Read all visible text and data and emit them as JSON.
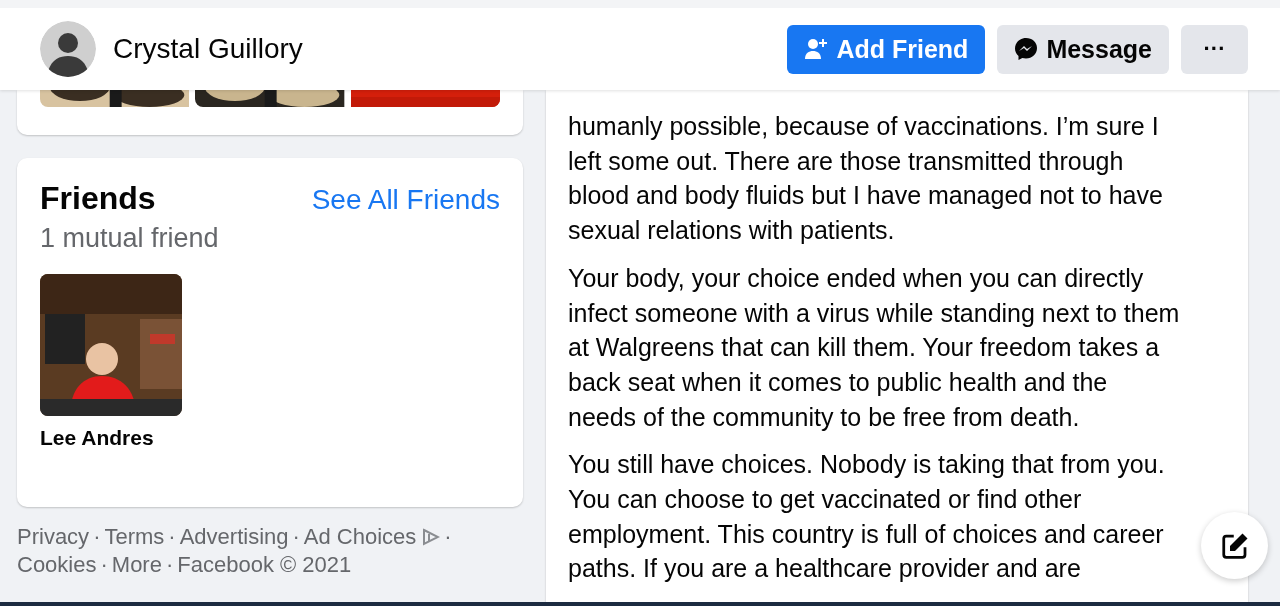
{
  "header": {
    "name": "Crystal Guillory",
    "buttons": [
      {
        "kind": "add_friend",
        "label": "Add Friend"
      },
      {
        "kind": "message",
        "label": "Message"
      },
      {
        "kind": "more",
        "label": "···"
      }
    ]
  },
  "friends": {
    "title": "Friends",
    "link": "See All Friends",
    "subtitle": "1 mutual friend",
    "items": [
      {
        "name": "Lee Andres"
      }
    ]
  },
  "footer": {
    "separator": "·",
    "links": [
      "Privacy",
      "Terms",
      "Advertising",
      "Ad Choices",
      "Cookies",
      "More"
    ],
    "copyright": "Facebook © 2021"
  },
  "post": {
    "paragraphs": [
      {
        "lines": [
          "humanly possible, because of vaccinations. I’m sure I",
          "left some out. There are those transmitted through",
          "blood and body fluids but I have managed not to have",
          "sexual relations with patients."
        ]
      },
      {
        "lines": [
          "Your body, your choice ended when you can directly",
          "infect someone with a virus while standing next to them",
          "at Walgreens that can kill them. Your freedom takes a",
          "back seat when it comes to public health and the",
          "needs of the community to be free from death."
        ]
      },
      {
        "lines": [
          "You still have choices. Nobody is taking that from you.",
          "You can choose to get vaccinated or find other",
          "employment. This country is full of choices and career",
          "paths. If you are a healthcare provider and are"
        ]
      }
    ]
  }
}
